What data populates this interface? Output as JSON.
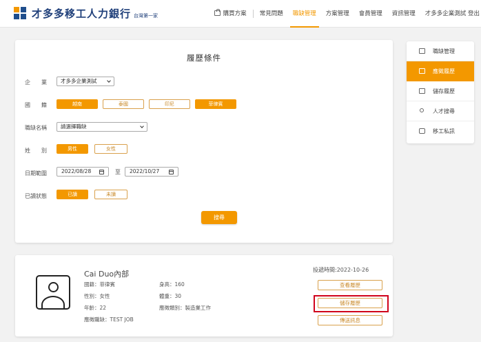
{
  "header": {
    "logo_text": "才多多移工人力銀行",
    "logo_sub": "台灣第一家",
    "nav": [
      "購買方案",
      "常見問題",
      "職缺管理",
      "方案管理",
      "會員管理",
      "資訊管理"
    ],
    "active_nav": "職缺管理",
    "user": "才多多企業測試",
    "logout": "登出",
    "accent_color": "#f39800"
  },
  "search": {
    "title": "履歷條件",
    "company_label": "企　　業",
    "company_value": "才多多企業測試",
    "nationality_label": "國　　籍",
    "nationalities": [
      "越南",
      "泰國",
      "印尼",
      "菲律賓"
    ],
    "job_label": "職缺名稱",
    "job_placeholder": "請選擇職缺",
    "gender_label": "姓　　別",
    "genders": [
      "男性",
      "女性"
    ],
    "date_label": "日期範圍",
    "date_from": "2022/08/28",
    "date_to_label": "至",
    "date_to": "2022/10/27",
    "read_label": "已讀狀態",
    "read_states": [
      "已讀",
      "未讀"
    ],
    "search_button": "搜尋"
  },
  "side_menu": {
    "items": [
      "職缺管理",
      "應徵履歷",
      "儲存履歷",
      "人才搜尋",
      "移工私訊"
    ],
    "active": "應徵履歷"
  },
  "result": {
    "name": "Cai Duo內部",
    "nationality": "國籍：菲律賓",
    "gender": "性別：女性",
    "age": "年齡：22",
    "job": "應徵職缺：TEST JOB",
    "height": "身高：160",
    "weight": "體重：30",
    "category": "應徵類別：製造業工作",
    "post_time": "投遞時間:2022-10-26",
    "btn_view": "查看履歷",
    "btn_save": "儲存履歷",
    "btn_message": "傳送訊息"
  }
}
